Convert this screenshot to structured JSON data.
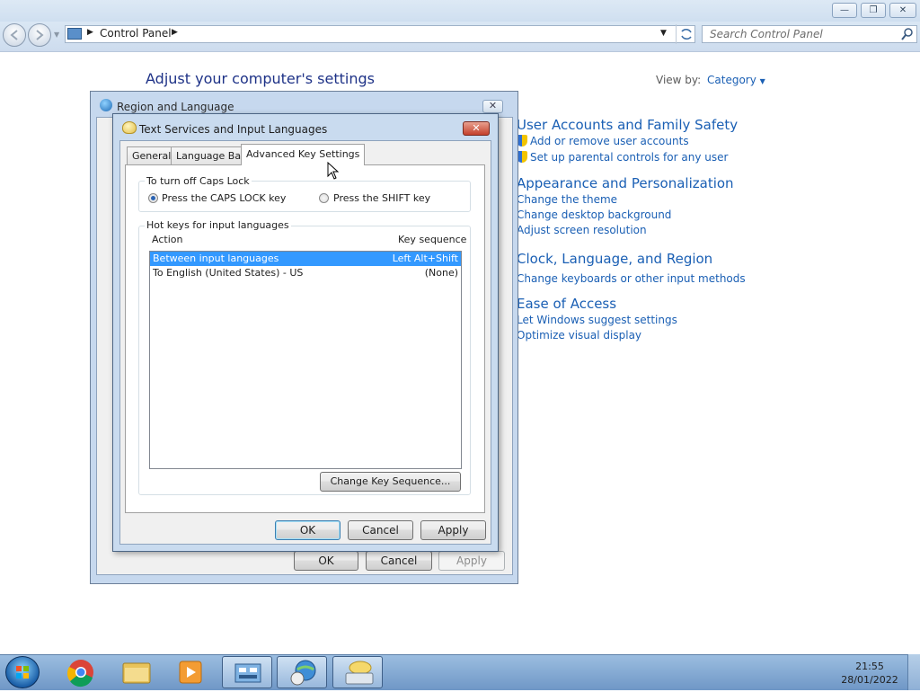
{
  "explorer": {
    "window_buttons": {
      "minimize": "—",
      "restore": "❐",
      "close": "✕"
    },
    "breadcrumb": "Control Panel",
    "search_placeholder": "Search Control Panel",
    "heading": "Adjust your computer's settings",
    "view_by_label": "View by:",
    "view_by_value": "Category",
    "categories": [
      {
        "title": "User Accounts and Family Safety",
        "links": [
          "Add or remove user accounts",
          "Set up parental controls for any user"
        ]
      },
      {
        "title": "Appearance and Personalization",
        "links": [
          "Change the theme",
          "Change desktop background",
          "Adjust screen resolution"
        ]
      },
      {
        "title": "Clock, Language, and Region",
        "links": [
          "Change keyboards or other input methods"
        ]
      },
      {
        "title": "Ease of Access",
        "links": [
          "Let Windows suggest settings",
          "Optimize visual display"
        ]
      }
    ]
  },
  "region_dialog": {
    "title": "Region and Language",
    "close": "✕",
    "buttons": {
      "ok": "OK",
      "cancel": "Cancel",
      "apply": "Apply"
    }
  },
  "text_services_dialog": {
    "title": "Text Services and Input Languages",
    "close": "✕",
    "tabs": [
      "General",
      "Language Bar",
      "Advanced Key Settings"
    ],
    "active_tab": "Advanced Key Settings",
    "caps_lock": {
      "group_label": "To turn off Caps Lock",
      "option_caps": "Press the CAPS LOCK key",
      "option_shift": "Press the SHIFT key",
      "selected": "Press the CAPS LOCK key"
    },
    "hotkeys": {
      "group_label": "Hot keys for input languages",
      "col_action": "Action",
      "col_key": "Key sequence",
      "rows": [
        {
          "action": "Between input languages",
          "key": "Left Alt+Shift",
          "selected": true
        },
        {
          "action": "To English (United States) - US",
          "key": "(None)",
          "selected": false
        }
      ],
      "change_button": "Change Key Sequence..."
    },
    "buttons": {
      "ok": "OK",
      "cancel": "Cancel",
      "apply": "Apply"
    }
  },
  "taskbar": {
    "time": "21:55",
    "date": "28/01/2022"
  },
  "colors": {
    "link": "#1a5fb4",
    "selection": "#3399ff",
    "heading": "#1e3287"
  }
}
